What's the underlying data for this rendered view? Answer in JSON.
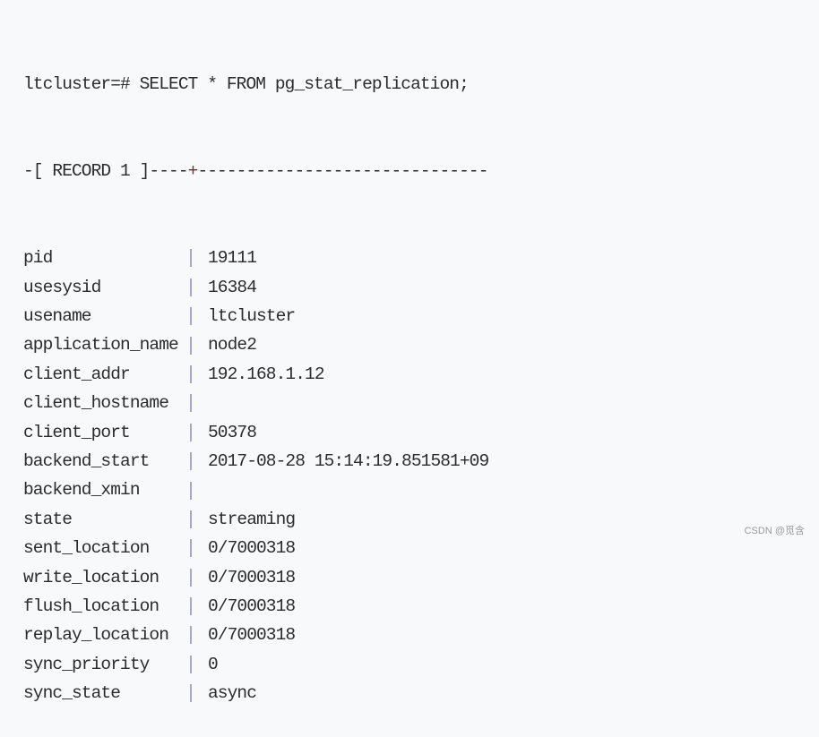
{
  "command": "ltcluster=# SELECT * FROM pg_stat_replication;",
  "record_header": {
    "prefix": "-[ RECORD 1 ]----",
    "plus": "+",
    "suffix": "------------------------------"
  },
  "rows": [
    {
      "key": "pid",
      "value": "19111"
    },
    {
      "key": "usesysid",
      "value": "16384"
    },
    {
      "key": "usename",
      "value": "ltcluster"
    },
    {
      "key": "application_name",
      "value": "node2"
    },
    {
      "key": "client_addr",
      "value": "192.168.1.12"
    },
    {
      "key": "client_hostname",
      "value": ""
    },
    {
      "key": "client_port",
      "value": "50378"
    },
    {
      "key": "backend_start",
      "value": "2017-08-28 15:14:19.851581+09"
    },
    {
      "key": "backend_xmin",
      "value": ""
    },
    {
      "key": "state",
      "value": "streaming"
    },
    {
      "key": "sent_location",
      "value": "0/7000318"
    },
    {
      "key": "write_location",
      "value": "0/7000318"
    },
    {
      "key": "flush_location",
      "value": "0/7000318"
    },
    {
      "key": "replay_location",
      "value": "0/7000318"
    },
    {
      "key": "sync_priority",
      "value": "0"
    },
    {
      "key": "sync_state",
      "value": "async"
    }
  ],
  "watermark": "CSDN @觅含",
  "colors": {
    "background": "#f8f9fb",
    "text": "#2b2b2b",
    "pipe": "#a3a6d6",
    "plus": "#7b2e1e"
  }
}
